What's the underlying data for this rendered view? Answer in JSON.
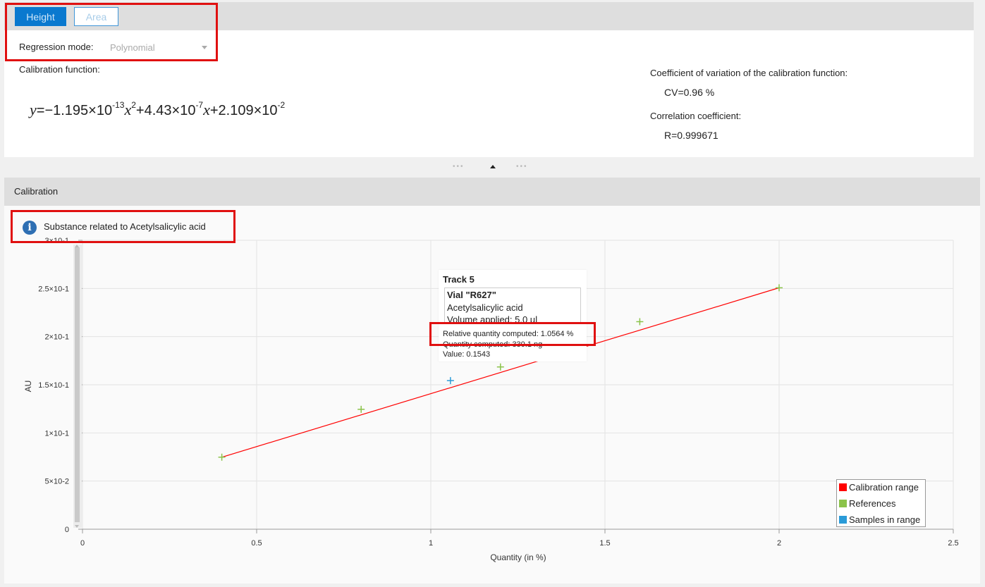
{
  "tabs": {
    "height_label": "Height",
    "area_label": "Area"
  },
  "regression": {
    "label": "Regression mode:",
    "value": "Polynomial"
  },
  "calibration_function": {
    "label": "Calibration function:",
    "y": "y",
    "x": "x",
    "formula_parts": [
      "=−1.195×10",
      "-13",
      "2",
      "+4.43×10",
      "-7",
      "+2.109×10",
      "-2"
    ]
  },
  "stats": {
    "cv_label": "Coefficient of variation of the calibration function:",
    "cv_value": "CV=0.96 %",
    "cc_label": "Correlation coefficient:",
    "cc_value": "R=0.999671"
  },
  "panel": {
    "title": "Calibration",
    "info_text": "Substance related to Acetylsalicylic acid"
  },
  "tooltip": {
    "title": "Track 5",
    "vial": "Vial \"R627\"",
    "substance": "Acetylsalicylic acid",
    "volume": "Volume applied: 5.0 µl",
    "relative": "Relative quantity computed: 1.0564 %",
    "quantity": "Quantity computed: 330.1 ng",
    "value": "Value: 0.1543"
  },
  "colors": {
    "accent": "#0a79cf",
    "calibration": "#ff0000",
    "references": "#8bc34a",
    "samples": "#2a9bd8",
    "highlight": "#e01010"
  },
  "chart_data": {
    "type": "scatter",
    "xlabel": "Quantity (in %)",
    "ylabel": "AU",
    "xlim": [
      0,
      2.5
    ],
    "ylim": [
      0,
      0.3
    ],
    "x_ticks": [
      "0",
      "0.5",
      "1",
      "1.5",
      "2",
      "2.5"
    ],
    "x_tick_values": [
      0,
      0.5,
      1,
      1.5,
      2,
      2.5
    ],
    "y_ticks": [
      "0",
      "5×10-2",
      "1×10-1",
      "1.5×10-1",
      "2×10-1",
      "2.5×10-1",
      "3×10-1"
    ],
    "y_tick_values": [
      0,
      0.05,
      0.1,
      0.15,
      0.2,
      0.25,
      0.3
    ],
    "calibration_line": {
      "name": "Calibration range",
      "x": [
        0.4,
        2.0
      ],
      "y": [
        0.0748,
        0.2507
      ]
    },
    "series": [
      {
        "name": "References",
        "x": [
          0.4,
          0.8,
          1.2,
          1.6,
          2.0
        ],
        "y": [
          0.0748,
          0.1245,
          0.1685,
          0.2155,
          0.2507
        ]
      },
      {
        "name": "Samples in range",
        "x": [
          1.0564
        ],
        "y": [
          0.1543
        ]
      }
    ],
    "legend_position": "bottom-right",
    "grid": true
  }
}
